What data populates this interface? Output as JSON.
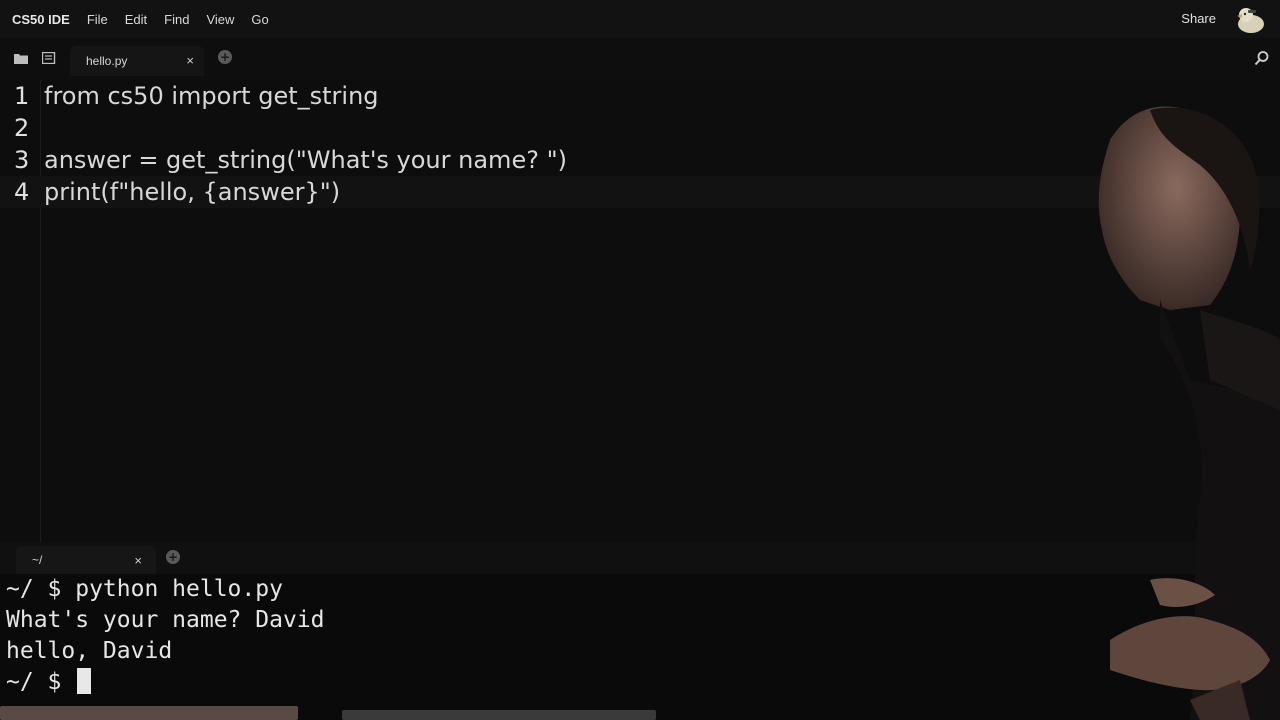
{
  "menubar": {
    "brand": "CS50 IDE",
    "items": [
      "File",
      "Edit",
      "Find",
      "View",
      "Go"
    ],
    "share_label": "Share",
    "avatar_icon": "duck-avatar-icon"
  },
  "editor_tabs": {
    "files_icon": "folder-icon",
    "outline_icon": "outline-icon",
    "active_tab": {
      "label": "hello.py",
      "close_label": "×"
    },
    "add_label": "+",
    "search_icon": "search-icon"
  },
  "editor": {
    "line_numbers": [
      "1",
      "2",
      "3",
      "4"
    ],
    "lines": [
      {
        "code": "from cs50 import get_string"
      },
      {
        "code": ""
      },
      {
        "code": "answer = get_string(\"What's your name? \")"
      },
      {
        "code": "print(f\"hello, {answer}\")"
      }
    ]
  },
  "terminal_tabs": {
    "active_tab": {
      "label": "~/",
      "close_label": "×"
    },
    "add_label": "+",
    "maximize_icon": "maximize-icon"
  },
  "terminal": {
    "lines": [
      "~/ $ python hello.py",
      "What's your name? David",
      "hello, David"
    ],
    "prompt": "~/ $ "
  },
  "colors": {
    "background": "#0b0b0b",
    "text": "#e6e6e6",
    "menubar": "#121212"
  }
}
